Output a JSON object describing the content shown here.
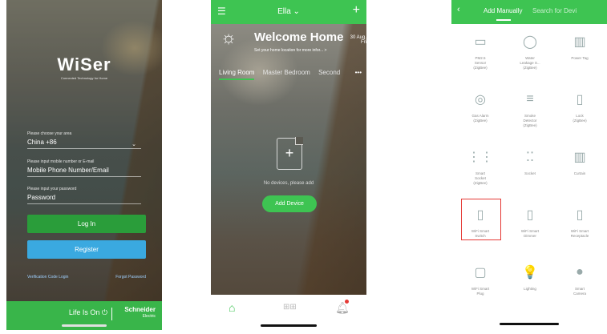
{
  "login": {
    "brand": "WiSer",
    "brand_tagline": "Connected Technology for Home",
    "area_label": "Please choose your area",
    "area_value": "China +86",
    "phone_label": "Please input mobile number or E-mail",
    "phone_value": "Mobile Phone Number/Email",
    "password_label": "Please input your password",
    "password_value": "Password",
    "login_button": "Log In",
    "register_button": "Register",
    "verification_link": "Verification Code Login",
    "forgot_link": "Forgot Password",
    "footer_slogan": "Life Is On",
    "footer_brand": "Schneider",
    "footer_brand_sub": "Electric",
    "primary_color": "#39b54a"
  },
  "home": {
    "user": "Ella ⌄",
    "welcome_title": "Welcome Home",
    "date": "30 Aug.",
    "weekday": "Fri",
    "welcome_sub": "Set your home location for more infor...  >",
    "tabs": [
      "Living Room",
      "Master Bedroom",
      "Second"
    ],
    "more": "•••",
    "empty_text": "No devices, please add",
    "add_device_button": "Add Device",
    "accent_color": "#3ec452"
  },
  "add": {
    "tab_active": "Add Manually",
    "tab_inactive": "Search for Devi",
    "devices": [
      {
        "label": "PM2.5\nSensor\n(ZigBee)",
        "icon": "▭"
      },
      {
        "label": "Water\nLeakage S...\n(ZigBee)",
        "icon": "◯"
      },
      {
        "label": "Power Tag",
        "icon": "▥"
      },
      {
        "label": "Gas Alarm\n(ZigBee)",
        "icon": "◎"
      },
      {
        "label": "Smoke\nDetector\n(ZigBee)",
        "icon": "≡"
      },
      {
        "label": "Lock\n(ZigBee)",
        "icon": "▯"
      },
      {
        "label": "Smart\nSocket\n(ZigBee)",
        "icon": "⋮⋮"
      },
      {
        "label": "Socket",
        "icon": "⁚⁚"
      },
      {
        "label": "Curtain",
        "icon": "▥"
      },
      {
        "label": "WiFi Smart\nSwitch",
        "icon": "▯"
      },
      {
        "label": "WiFi Smart\nDimmer",
        "icon": "▯"
      },
      {
        "label": "WiFi Smart\nReceptacle",
        "icon": "▯"
      },
      {
        "label": "WiFi Smart\nPlug",
        "icon": "▢"
      },
      {
        "label": "Lighting",
        "icon": "💡"
      },
      {
        "label": "Smart\nCamera",
        "icon": "●"
      }
    ],
    "highlight_color": "#e53935"
  }
}
